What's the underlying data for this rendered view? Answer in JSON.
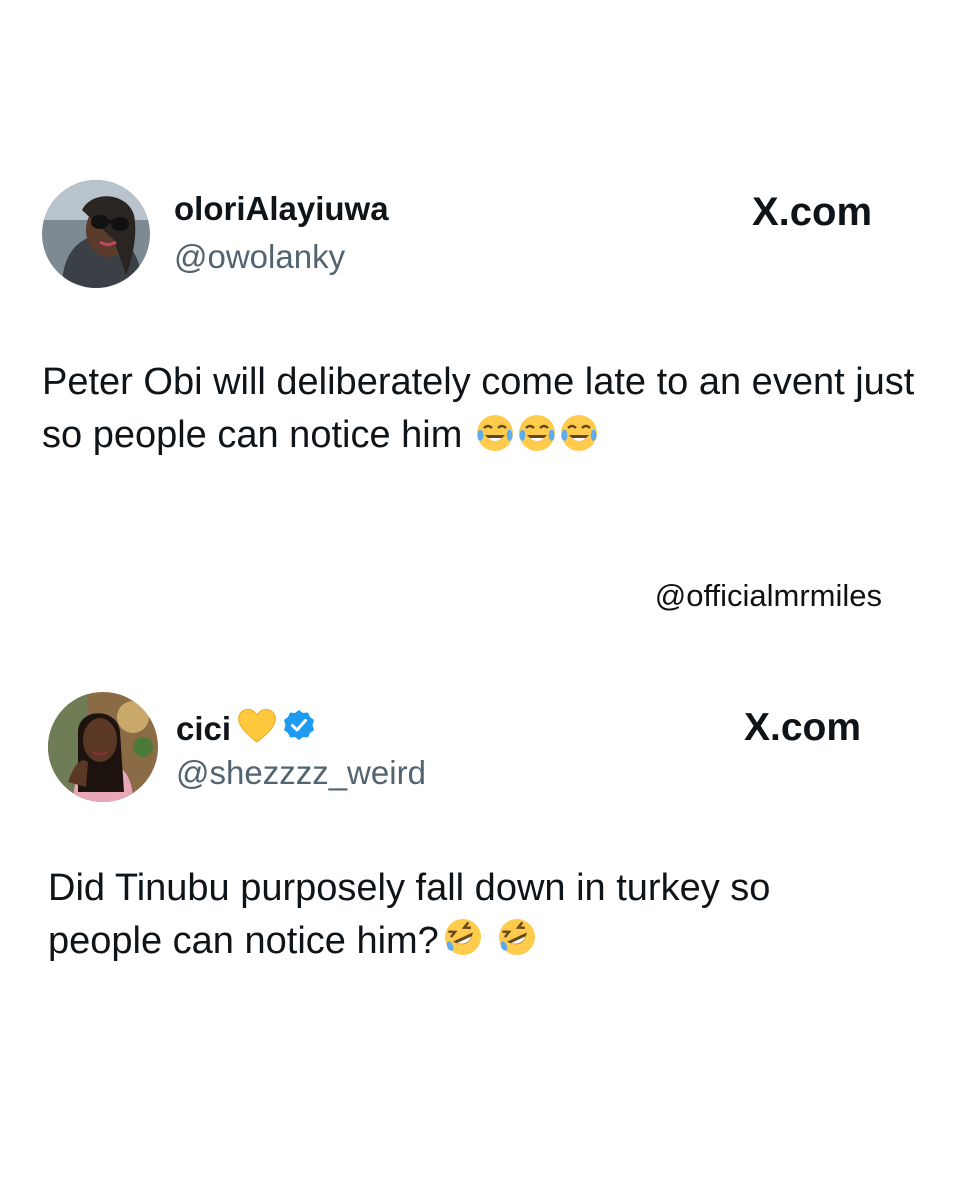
{
  "tweets": [
    {
      "name": "oloriAlayiuwa",
      "handle": "@owolanky",
      "site": "X.com",
      "text": "Peter Obi will deliberately come late to an event just so people can notice him",
      "emojis": [
        "face-with-tears-of-joy",
        "face-with-tears-of-joy",
        "face-with-tears-of-joy"
      ],
      "verified": false
    },
    {
      "name": "cici",
      "name_emoji": "yellow-heart",
      "handle": "@shezzzz_weird",
      "site": "X.com",
      "text": "Did Tinubu purposely fall down in turkey so people can notice him?",
      "emojis": [
        "rolling-on-the-floor-laughing",
        "rolling-on-the-floor-laughing"
      ],
      "verified": true
    }
  ],
  "watermark": "@officialmrmiles",
  "colors": {
    "text": "#0f1419",
    "handle": "#536471",
    "verified": "#1d9bf0",
    "heart": "#ffc83d",
    "emoji_face": "#ffcb4c"
  }
}
